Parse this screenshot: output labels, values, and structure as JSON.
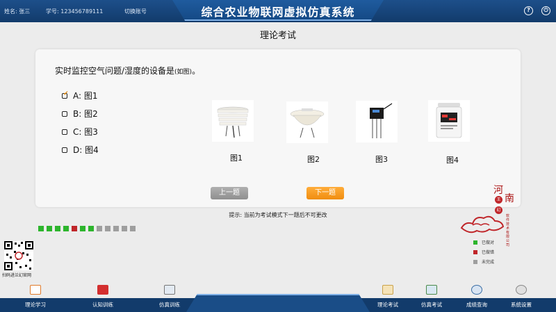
{
  "header": {
    "name_label": "姓名: 张三",
    "id_label": "学号: 123456789111",
    "switch_account": "切换账号",
    "title": "综合农业物联网虚拟仿真系统",
    "help_icon": "help-icon",
    "power_icon": "power-icon"
  },
  "page": {
    "title": "理论考试"
  },
  "question": {
    "text": "实时监控空气问题/湿度的设备是",
    "suffix": "(如图)",
    "end": "。",
    "options": [
      {
        "label": "A: 图1",
        "checked": true
      },
      {
        "label": "B: 图2",
        "checked": false
      },
      {
        "label": "C: 图3",
        "checked": false
      },
      {
        "label": "D: 图4",
        "checked": false
      }
    ],
    "figures": [
      "图1",
      "图2",
      "图3",
      "图4"
    ]
  },
  "buttons": {
    "prev": "上一题",
    "next": "下一题"
  },
  "hint": "提示: 当前为考试模式下一题后不可更改",
  "progress": [
    "done",
    "done",
    "done",
    "done",
    "wrong",
    "done",
    "done",
    "todo",
    "todo",
    "todo",
    "todo",
    "todo"
  ],
  "colors": {
    "done": "#2db52d",
    "wrong": "#c0262a",
    "todo": "#9e9e9e",
    "accent": "#f08d10",
    "header": "#123b6b"
  },
  "legend": [
    {
      "label": "已做对",
      "status": "done"
    },
    {
      "label": "已做错",
      "status": "wrong"
    },
    {
      "label": "未完成",
      "status": "todo"
    }
  ],
  "brand": {
    "char1": "河",
    "char2": "南",
    "dot1": "王",
    "dot2": "幻",
    "vertical": "软件技术有限公司",
    "qr_caption": "扫码进兰幻官网"
  },
  "nav": [
    {
      "label": "理论学习",
      "icon": "calendar-icon"
    },
    {
      "label": "认知训练",
      "icon": "book-icon"
    },
    {
      "label": "仿真训练",
      "icon": "monitor-icon"
    },
    {
      "label": "理论考试",
      "icon": "clipboard-icon"
    },
    {
      "label": "仿真考试",
      "icon": "chart-monitor-icon"
    },
    {
      "label": "成绩查询",
      "icon": "search-icon"
    },
    {
      "label": "系统设置",
      "icon": "gear-icon"
    }
  ]
}
